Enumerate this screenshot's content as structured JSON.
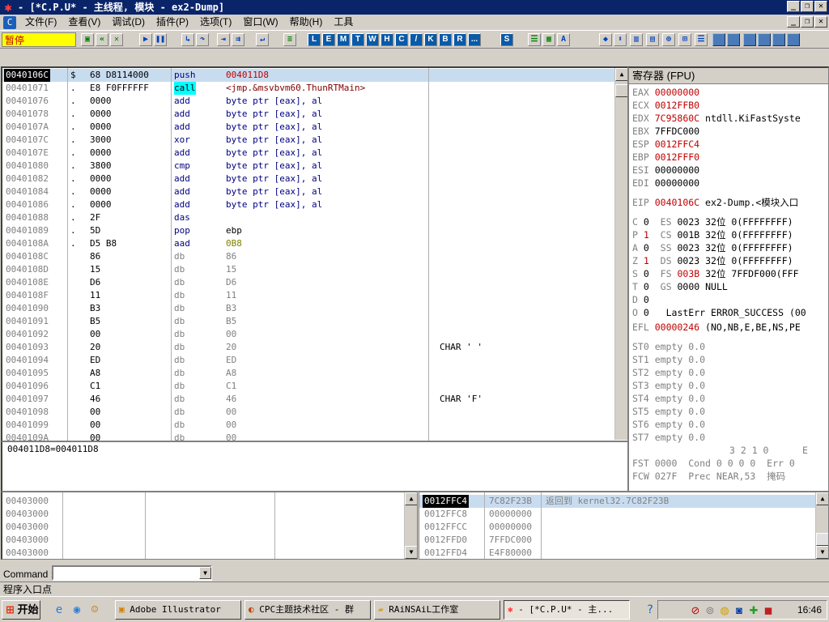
{
  "window": {
    "title": "- [*C.P.U* -  主线程, 模块 - ex2-Dump]",
    "min": "_",
    "max": "❐",
    "close": "✕"
  },
  "menu": [
    "文件(F)",
    "查看(V)",
    "调试(D)",
    "插件(P)",
    "选项(T)",
    "窗口(W)",
    "帮助(H)",
    "工具"
  ],
  "toolbar": {
    "state": "暂停",
    "letters": [
      "L",
      "E",
      "M",
      "T",
      "W",
      "H",
      "C",
      "/",
      "K",
      "B",
      "R",
      "...",
      "S"
    ]
  },
  "disasm": {
    "rows": [
      {
        "addr": "0040106C",
        "sym": "$",
        "hex": "68 D8114000",
        "mnem": "push",
        "ops": "004011D8",
        "cmt": ""
      },
      {
        "addr": "00401071",
        "sym": ".",
        "hex": "E8 F0FFFFFF",
        "mnem": "call",
        "ops": "<jmp.&msvbvm60.ThunRTMain>",
        "cmt": ""
      },
      {
        "addr": "00401076",
        "sym": ".",
        "hex": "0000",
        "mnem": "add",
        "ops": "byte ptr [eax], al",
        "cmt": ""
      },
      {
        "addr": "00401078",
        "sym": ".",
        "hex": "0000",
        "mnem": "add",
        "ops": "byte ptr [eax], al",
        "cmt": ""
      },
      {
        "addr": "0040107A",
        "sym": ".",
        "hex": "0000",
        "mnem": "add",
        "ops": "byte ptr [eax], al",
        "cmt": ""
      },
      {
        "addr": "0040107C",
        "sym": ".",
        "hex": "3000",
        "mnem": "xor",
        "ops": "byte ptr [eax], al",
        "cmt": ""
      },
      {
        "addr": "0040107E",
        "sym": ".",
        "hex": "0000",
        "mnem": "add",
        "ops": "byte ptr [eax], al",
        "cmt": ""
      },
      {
        "addr": "00401080",
        "sym": ".",
        "hex": "3800",
        "mnem": "cmp",
        "ops": "byte ptr [eax], al",
        "cmt": ""
      },
      {
        "addr": "00401082",
        "sym": ".",
        "hex": "0000",
        "mnem": "add",
        "ops": "byte ptr [eax], al",
        "cmt": ""
      },
      {
        "addr": "00401084",
        "sym": ".",
        "hex": "0000",
        "mnem": "add",
        "ops": "byte ptr [eax], al",
        "cmt": ""
      },
      {
        "addr": "00401086",
        "sym": ".",
        "hex": "0000",
        "mnem": "add",
        "ops": "byte ptr [eax], al",
        "cmt": ""
      },
      {
        "addr": "00401088",
        "sym": ".",
        "hex": "2F",
        "mnem": "das",
        "ops": "",
        "cmt": ""
      },
      {
        "addr": "00401089",
        "sym": ".",
        "hex": "5D",
        "mnem": "pop",
        "ops": "ebp",
        "cmt": ""
      },
      {
        "addr": "0040108A",
        "sym": ".",
        "hex": "D5 B8",
        "mnem": "aad",
        "ops": "0B8",
        "cmt": ""
      },
      {
        "addr": "0040108C",
        "sym": "",
        "hex": "86",
        "mnem": "db",
        "ops": "86",
        "cmt": ""
      },
      {
        "addr": "0040108D",
        "sym": "",
        "hex": "15",
        "mnem": "db",
        "ops": "15",
        "cmt": ""
      },
      {
        "addr": "0040108E",
        "sym": "",
        "hex": "D6",
        "mnem": "db",
        "ops": "D6",
        "cmt": ""
      },
      {
        "addr": "0040108F",
        "sym": "",
        "hex": "11",
        "mnem": "db",
        "ops": "11",
        "cmt": ""
      },
      {
        "addr": "00401090",
        "sym": "",
        "hex": "B3",
        "mnem": "db",
        "ops": "B3",
        "cmt": ""
      },
      {
        "addr": "00401091",
        "sym": "",
        "hex": "B5",
        "mnem": "db",
        "ops": "B5",
        "cmt": ""
      },
      {
        "addr": "00401092",
        "sym": "",
        "hex": "00",
        "mnem": "db",
        "ops": "00",
        "cmt": ""
      },
      {
        "addr": "00401093",
        "sym": "",
        "hex": "20",
        "mnem": "db",
        "ops": "20",
        "cmt": "CHAR ' '"
      },
      {
        "addr": "00401094",
        "sym": "",
        "hex": "ED",
        "mnem": "db",
        "ops": "ED",
        "cmt": ""
      },
      {
        "addr": "00401095",
        "sym": "",
        "hex": "A8",
        "mnem": "db",
        "ops": "A8",
        "cmt": ""
      },
      {
        "addr": "00401096",
        "sym": "",
        "hex": "C1",
        "mnem": "db",
        "ops": "C1",
        "cmt": ""
      },
      {
        "addr": "00401097",
        "sym": "",
        "hex": "46",
        "mnem": "db",
        "ops": "46",
        "cmt": "CHAR 'F'"
      },
      {
        "addr": "00401098",
        "sym": "",
        "hex": "00",
        "mnem": "db",
        "ops": "00",
        "cmt": ""
      },
      {
        "addr": "00401099",
        "sym": "",
        "hex": "00",
        "mnem": "db",
        "ops": "00",
        "cmt": ""
      },
      {
        "addr": "0040109A",
        "sym": "",
        "hex": "00",
        "mnem": "db",
        "ops": "00",
        "cmt": ""
      }
    ]
  },
  "info": "004011D8=004011D8",
  "registers": {
    "header": "寄存器 (FPU)",
    "gp": [
      {
        "name": "EAX",
        "val": "00000000",
        "note": "",
        "changed": true
      },
      {
        "name": "ECX",
        "val": "0012FFB0",
        "note": "",
        "changed": true
      },
      {
        "name": "EDX",
        "val": "7C95860C",
        "note": "ntdll.KiFastSyste",
        "changed": true
      },
      {
        "name": "EBX",
        "val": "7FFDC000",
        "note": "",
        "changed": false
      },
      {
        "name": "ESP",
        "val": "0012FFC4",
        "note": "",
        "changed": true
      },
      {
        "name": "EBP",
        "val": "0012FFF0",
        "note": "",
        "changed": true
      },
      {
        "name": "ESI",
        "val": "00000000",
        "note": "",
        "changed": false
      },
      {
        "name": "EDI",
        "val": "00000000",
        "note": "",
        "changed": false
      }
    ],
    "eip": {
      "name": "EIP",
      "val": "0040106C",
      "note": "ex2-Dump.<模块入口"
    },
    "flags": [
      {
        "f": "C",
        "v": "0",
        "seg": "ES",
        "sv": "0023",
        "bits": "32位",
        "base": "0(FFFFFFFF)",
        "vred": false,
        "svred": false
      },
      {
        "f": "P",
        "v": "1",
        "seg": "CS",
        "sv": "001B",
        "bits": "32位",
        "base": "0(FFFFFFFF)",
        "vred": true,
        "svred": false
      },
      {
        "f": "A",
        "v": "0",
        "seg": "SS",
        "sv": "0023",
        "bits": "32位",
        "base": "0(FFFFFFFF)",
        "vred": false,
        "svred": false
      },
      {
        "f": "Z",
        "v": "1",
        "seg": "DS",
        "sv": "0023",
        "bits": "32位",
        "base": "0(FFFFFFFF)",
        "vred": true,
        "svred": false
      },
      {
        "f": "S",
        "v": "0",
        "seg": "FS",
        "sv": "003B",
        "bits": "32位",
        "base": "7FFDF000(FFF",
        "vred": false,
        "svred": true
      },
      {
        "f": "T",
        "v": "0",
        "seg": "GS",
        "sv": "0000",
        "bits": "NULL",
        "base": "",
        "vred": false,
        "svred": false
      },
      {
        "f": "D",
        "v": "0",
        "seg": "",
        "sv": "",
        "bits": "",
        "base": "",
        "vred": false,
        "svred": false
      },
      {
        "f": "O",
        "v": "0",
        "seg": "",
        "sv": "LastErr",
        "bits": "ERROR_SUCCESS (00",
        "base": "",
        "vred": false,
        "svred": false
      }
    ],
    "efl": {
      "name": "EFL",
      "val": "00000246",
      "note": "(NO,NB,E,BE,NS,PE"
    },
    "st": [
      "ST0 empty 0.0",
      "ST1 empty 0.0",
      "ST2 empty 0.0",
      "ST3 empty 0.0",
      "ST4 empty 0.0",
      "ST5 empty 0.0",
      "ST6 empty 0.0",
      "ST7 empty 0.0"
    ],
    "fpu_hdr": "3 2 1 0      E",
    "fst": "FST 0000  Cond 0 0 0 0  Err 0",
    "fcw": "FCW 027F  Prec NEAR,53  掩码"
  },
  "dump": {
    "rows": [
      "00403000",
      "00403000",
      "00403000",
      "00403000",
      "00403000"
    ]
  },
  "stack": {
    "rows": [
      {
        "addr": "0012FFC4",
        "val": "7C82F23B",
        "cmt": "返回到 kernel32.7C82F23B"
      },
      {
        "addr": "0012FFC8",
        "val": "00000000",
        "cmt": ""
      },
      {
        "addr": "0012FFCC",
        "val": "00000000",
        "cmt": ""
      },
      {
        "addr": "0012FFD0",
        "val": "7FFDC000",
        "cmt": ""
      },
      {
        "addr": "0012FFD4",
        "val": "E4F80000",
        "cmt": ""
      }
    ]
  },
  "command": {
    "label": "Command :",
    "value": ""
  },
  "status": "程序入口点",
  "taskbar": {
    "start": "开始",
    "tasks": [
      "Adobe Illustrator",
      "CPC主题技术社区 - 群",
      "RAiNSAiL工作室",
      "- [*C.P.U* - 主..."
    ],
    "clock": "16:46"
  }
}
